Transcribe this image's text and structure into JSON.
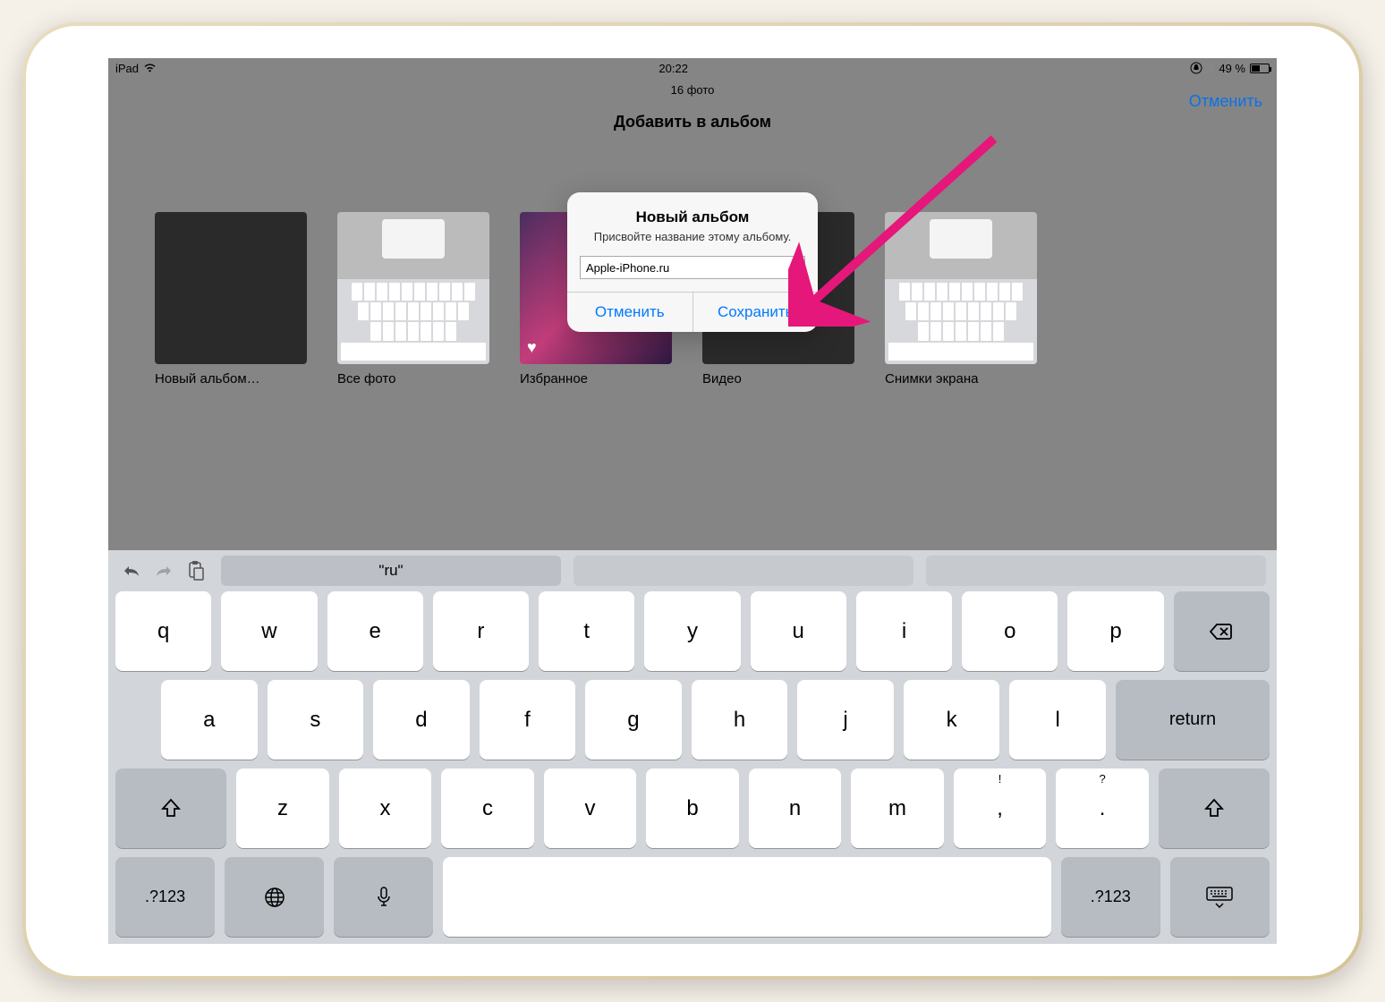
{
  "status": {
    "device": "iPad",
    "time": "20:22",
    "battery_pct": "49 %"
  },
  "header": {
    "photo_count": "16 фото",
    "title": "Добавить в альбом",
    "cancel": "Отменить"
  },
  "albums": [
    {
      "label": "Новый альбом…"
    },
    {
      "label": "Все фото"
    },
    {
      "label": "Избранное"
    },
    {
      "label": "Видео"
    },
    {
      "label": "Снимки экрана"
    }
  ],
  "alert": {
    "title": "Новый альбом",
    "message": "Присвойте название этому альбому.",
    "input_value": "Apple-iPhone.ru",
    "cancel": "Отменить",
    "save": "Сохранить"
  },
  "keyboard": {
    "suggestion": "\"ru\"",
    "row1": [
      "q",
      "w",
      "e",
      "r",
      "t",
      "y",
      "u",
      "i",
      "o",
      "p"
    ],
    "row2": [
      "a",
      "s",
      "d",
      "f",
      "g",
      "h",
      "j",
      "k",
      "l"
    ],
    "row3": [
      "z",
      "x",
      "c",
      "v",
      "b",
      "n",
      "m"
    ],
    "punctuation": {
      "exclaim_sub": "!",
      "comma": ",",
      "question_sub": "?",
      "period": "."
    },
    "return": "return",
    "numeric": ".?123"
  }
}
